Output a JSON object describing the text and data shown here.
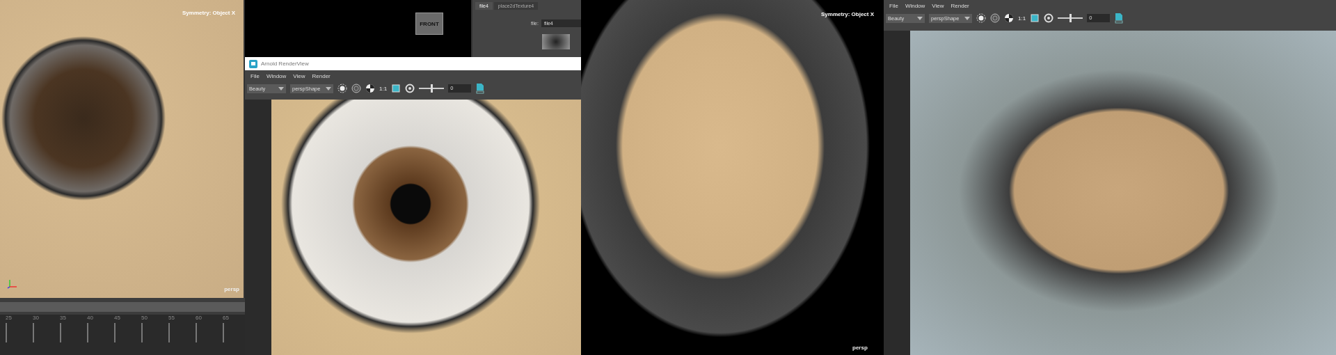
{
  "left_viewport": {
    "hud": "Symmetry: Object X",
    "camera": "persp"
  },
  "timeline": {
    "ticks": [
      "25",
      "30",
      "35",
      "40",
      "45",
      "50",
      "55",
      "60",
      "65"
    ]
  },
  "view_cube": {
    "label": "FRONT"
  },
  "attribute_editor": {
    "tabs": [
      {
        "label": "file4",
        "selected": true
      },
      {
        "label": "place2dTexture4",
        "selected": false
      }
    ],
    "file_label": "file:",
    "file_value": "file4"
  },
  "render_view": {
    "title": "Arnold RenderView",
    "menu": [
      "File",
      "Window",
      "View",
      "Render"
    ],
    "toolbar": {
      "aov": "Beauty",
      "camera": "perspShape",
      "zoom": "1:1",
      "exposure": "0",
      "level": 0.5
    }
  },
  "center_viewport": {
    "hud": "Symmetry: Object X",
    "camera": "persp"
  },
  "right_render_view": {
    "menu": [
      "File",
      "Window",
      "View",
      "Render"
    ],
    "toolbar": {
      "aov": "Beauty",
      "camera": "perspShape",
      "zoom": "1:1",
      "exposure": "0",
      "level": 0.5
    }
  }
}
